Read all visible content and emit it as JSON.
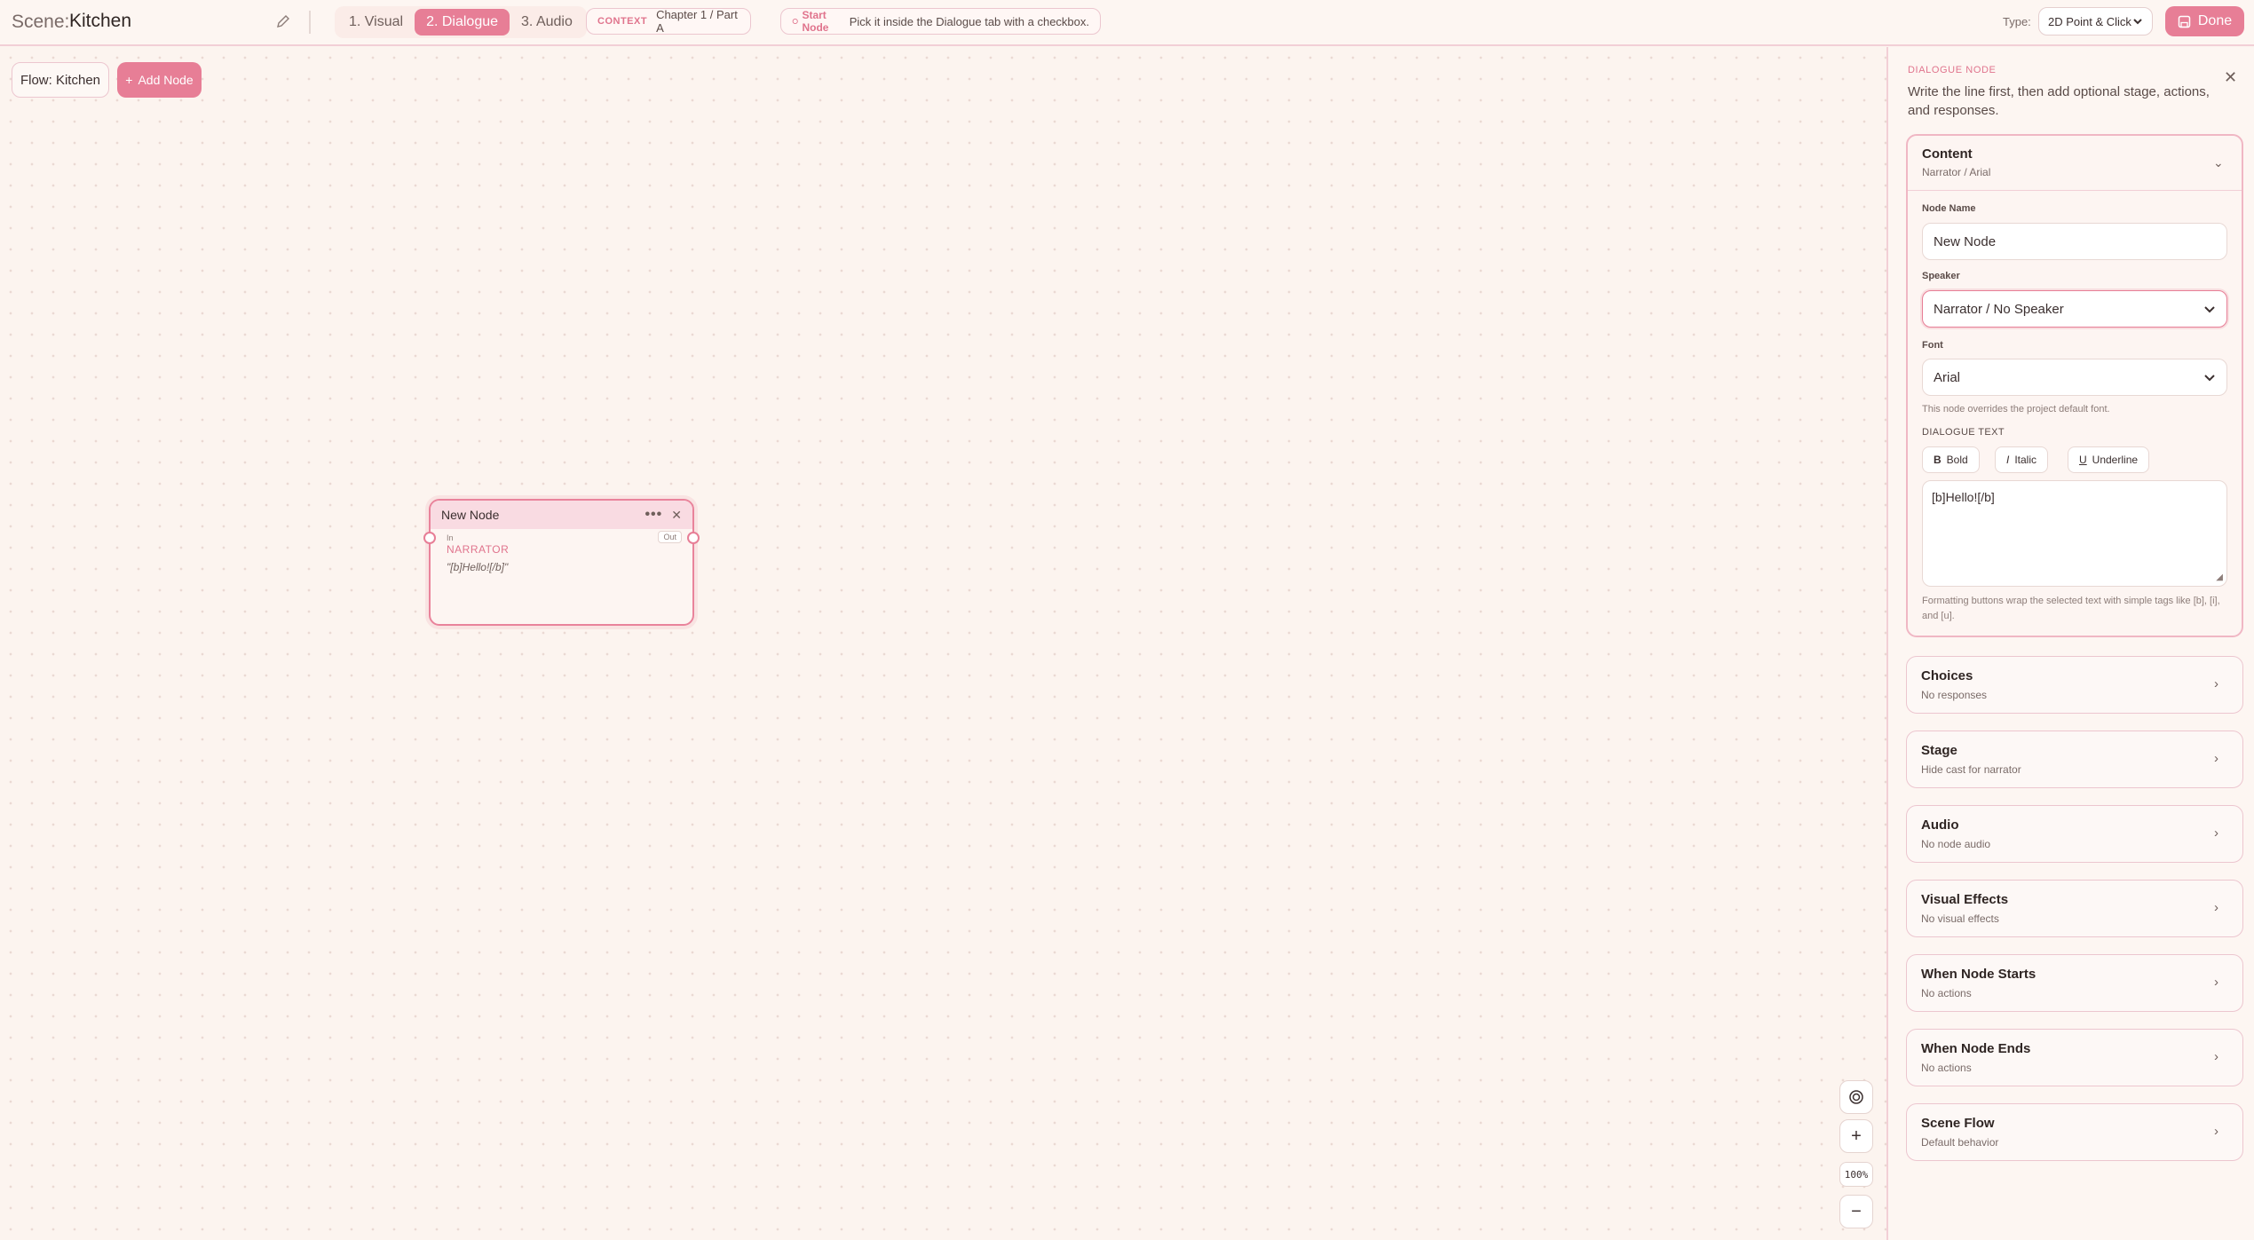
{
  "header": {
    "scene_label": "Scene:",
    "scene_name": "Kitchen",
    "tabs": [
      {
        "label": "1. Visual"
      },
      {
        "label": "2. Dialogue"
      },
      {
        "label": "3. Audio"
      }
    ],
    "context_key": "CONTEXT",
    "context_value": "Chapter 1 / Part A",
    "start_node_key": "Start Node",
    "start_node_value": "Pick it inside the Dialogue tab with a checkbox.",
    "type_label": "Type:",
    "type_value": "2D Point & Click",
    "done_label": "Done"
  },
  "canvas": {
    "flow_label": "Flow: Kitchen",
    "add_node_label": "Add Node",
    "zoom_level": "100%",
    "node": {
      "title": "New Node",
      "in_label": "In",
      "out_label": "Out",
      "speaker": "NARRATOR",
      "text": "\"[b]Hello![/b]\""
    }
  },
  "panel": {
    "kicker": "DIALOGUE NODE",
    "description": "Write the line first, then add optional stage, actions, and responses.",
    "content": {
      "title": "Content",
      "subtitle": "Narrator / Arial",
      "node_name_label": "Node Name",
      "node_name_value": "New Node",
      "speaker_label": "Speaker",
      "speaker_value": "Narrator / No Speaker",
      "font_label": "Font",
      "font_value": "Arial",
      "font_hint": "This node overrides the project default font.",
      "dialogue_label": "DIALOGUE TEXT",
      "bold_label": "Bold",
      "italic_label": "Italic",
      "underline_label": "Underline",
      "dialogue_value": "[b]Hello![/b]",
      "format_hint": "Formatting buttons wrap the selected text with simple tags like [b], [i], and [u]."
    },
    "sections": [
      {
        "title": "Choices",
        "subtitle": "No responses"
      },
      {
        "title": "Stage",
        "subtitle": "Hide cast for narrator"
      },
      {
        "title": "Audio",
        "subtitle": "No node audio"
      },
      {
        "title": "Visual Effects",
        "subtitle": "No visual effects"
      },
      {
        "title": "When Node Starts",
        "subtitle": "No actions"
      },
      {
        "title": "When Node Ends",
        "subtitle": "No actions"
      },
      {
        "title": "Scene Flow",
        "subtitle": "Default behavior"
      }
    ]
  },
  "colors": {
    "accent": "#e77e96",
    "background": "#fcf4ef",
    "border": "#f2cfd6"
  }
}
